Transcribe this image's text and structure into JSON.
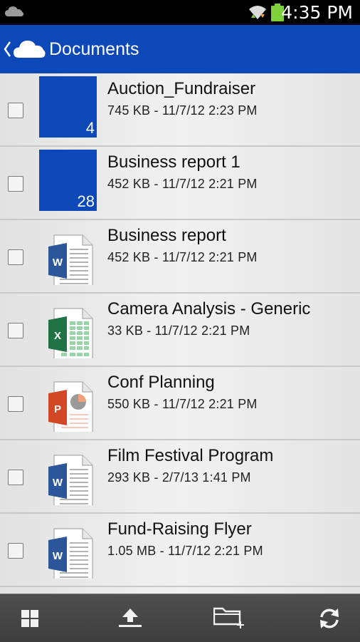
{
  "status_bar": {
    "time": "4:35 PM",
    "icons": [
      "onedrive-cloud-icon",
      "wifi-icon",
      "battery-icon"
    ]
  },
  "app_bar": {
    "title": "Documents",
    "icons": [
      "back-caret-icon",
      "onedrive-logo-icon"
    ]
  },
  "files": [
    {
      "name": "Auction_Fundraiser",
      "meta": "745 KB - 11/7/12 2:23 PM",
      "kind": "folder",
      "count": "4"
    },
    {
      "name": "Business report 1",
      "meta": "452 KB - 11/7/12 2:21 PM",
      "kind": "folder",
      "count": "28"
    },
    {
      "name": "Business report",
      "meta": "452 KB - 11/7/12 2:21 PM",
      "kind": "word"
    },
    {
      "name": "Camera Analysis - Generic",
      "meta": "33 KB - 11/7/12 2:21 PM",
      "kind": "excel"
    },
    {
      "name": "Conf Planning",
      "meta": "550 KB - 11/7/12 2:21 PM",
      "kind": "powerpoint"
    },
    {
      "name": "Film Festival Program",
      "meta": "293 KB - 2/7/13 1:41 PM",
      "kind": "word"
    },
    {
      "name": "Fund-Raising Flyer",
      "meta": "1.05 MB - 11/7/12 2:21 PM",
      "kind": "word"
    }
  ],
  "doc_badges": {
    "word": "W",
    "excel": "X",
    "powerpoint": "P"
  },
  "bottom_bar": {
    "actions": [
      "grid-view-icon",
      "upload-icon",
      "new-folder-icon",
      "refresh-icon"
    ]
  },
  "colors": {
    "brand_blue": "#0c48b7",
    "word_blue": "#2b579a",
    "excel_green": "#217346",
    "powerpoint_orange": "#d24726",
    "battery_green": "#7fd13b"
  }
}
